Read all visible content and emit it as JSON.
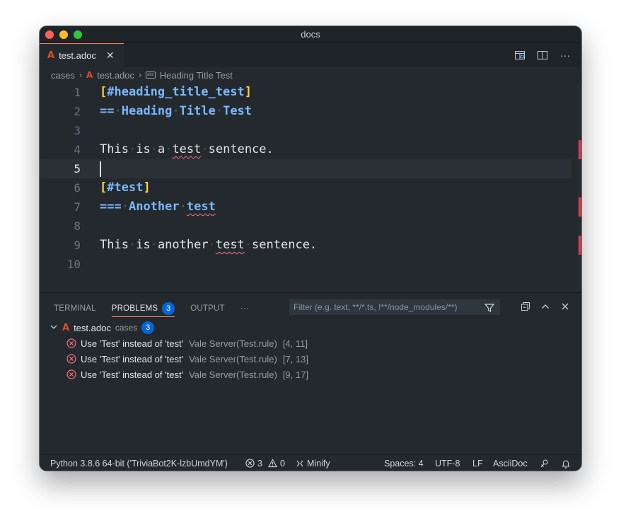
{
  "window": {
    "title": "docs"
  },
  "tab": {
    "filename": "test.adoc",
    "icon": "asciidoc-icon"
  },
  "breadcrumb": {
    "folder": "cases",
    "file": "test.adoc",
    "symbol": "Heading Title Test"
  },
  "editor": {
    "lines": [
      {
        "n": "1",
        "text": "[#heading_title_test]"
      },
      {
        "n": "2",
        "text": "== Heading Title Test"
      },
      {
        "n": "3",
        "text": ""
      },
      {
        "n": "4",
        "text": "This is a test sentence."
      },
      {
        "n": "5",
        "text": ""
      },
      {
        "n": "6",
        "text": "[#test]"
      },
      {
        "n": "7",
        "text": "=== Another test"
      },
      {
        "n": "8",
        "text": ""
      },
      {
        "n": "9",
        "text": "This is another test sentence."
      },
      {
        "n": "10",
        "text": ""
      }
    ],
    "active_line": 5
  },
  "panel": {
    "tabs": {
      "terminal": "TERMINAL",
      "problems": "PROBLEMS",
      "problems_count": "3",
      "output": "OUTPUT",
      "more": "···"
    },
    "filter_placeholder": "Filter (e.g. text, **/*.ts, !**/node_modules/**)",
    "group": {
      "file": "test.adoc",
      "folder": "cases",
      "count": "3"
    },
    "problems": [
      {
        "message": "Use 'Test' instead of 'test'",
        "source": "Vale Server(Test.rule)",
        "position": "[4, 11]"
      },
      {
        "message": "Use 'Test' instead of 'test'",
        "source": "Vale Server(Test.rule)",
        "position": "[7, 13]"
      },
      {
        "message": "Use 'Test' instead of 'test'",
        "source": "Vale Server(Test.rule)",
        "position": "[9, 17]"
      }
    ]
  },
  "status": {
    "python": "Python 3.8.6 64-bit ('TriviaBot2K-lzbUmdYM')",
    "errors": "3",
    "warnings": "0",
    "minify": "Minify",
    "spaces": "Spaces: 4",
    "encoding": "UTF-8",
    "eol": "LF",
    "language": "AsciiDoc"
  },
  "colors": {
    "accent": "#f9826c",
    "badge": "#0366d6",
    "error": "#f97583",
    "heading": "#79b8ff",
    "bracket": "#ffd33d"
  }
}
